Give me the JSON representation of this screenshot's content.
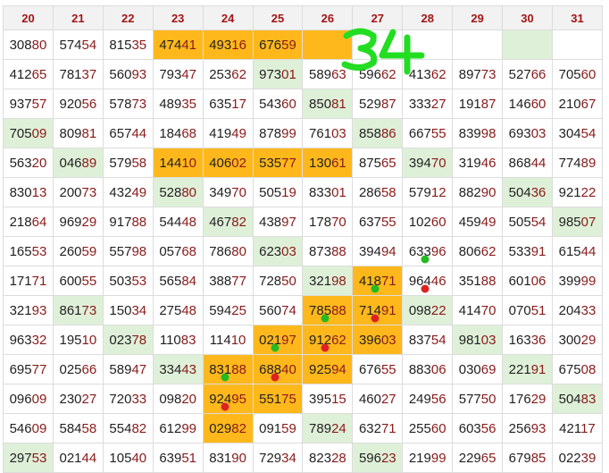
{
  "headers": [
    "20",
    "21",
    "22",
    "23",
    "24",
    "25",
    "26",
    "27",
    "28",
    "29",
    "30",
    "31"
  ],
  "rows": [
    [
      "30880",
      "57454",
      "81535",
      "47441",
      "49316",
      "67659",
      "",
      "",
      "",
      "",
      "",
      ""
    ],
    [
      "41265",
      "78137",
      "56093",
      "79347",
      "25362",
      "97301",
      "58963",
      "59662",
      "41362",
      "89773",
      "52766",
      "70560"
    ],
    [
      "93757",
      "92056",
      "57873",
      "48935",
      "63517",
      "54360",
      "85081",
      "52987",
      "33327",
      "19187",
      "14660",
      "21067"
    ],
    [
      "70509",
      "80981",
      "65744",
      "18468",
      "41949",
      "87899",
      "76103",
      "85886",
      "66755",
      "83998",
      "69303",
      "30454"
    ],
    [
      "56320",
      "04689",
      "57958",
      "14410",
      "40602",
      "53577",
      "13061",
      "87565",
      "39470",
      "31946",
      "86844",
      "77489"
    ],
    [
      "83013",
      "20073",
      "43249",
      "52880",
      "34970",
      "50519",
      "83301",
      "28658",
      "57912",
      "88290",
      "50436",
      "92122"
    ],
    [
      "21864",
      "96929",
      "91788",
      "54448",
      "46782",
      "43897",
      "17870",
      "63755",
      "10260",
      "45949",
      "50554",
      "98507"
    ],
    [
      "16553",
      "26059",
      "55798",
      "05768",
      "78680",
      "62303",
      "87388",
      "39494",
      "63396",
      "80662",
      "53391",
      "61544"
    ],
    [
      "17171",
      "60055",
      "50353",
      "56584",
      "38877",
      "72850",
      "32198",
      "41871",
      "96446",
      "35188",
      "60106",
      "39999"
    ],
    [
      "32193",
      "86173",
      "15034",
      "27548",
      "59425",
      "56074",
      "78588",
      "71491",
      "09822",
      "41470",
      "07051",
      "20433"
    ],
    [
      "96332",
      "19510",
      "02378",
      "11083",
      "11410",
      "02197",
      "91262",
      "39603",
      "83754",
      "98103",
      "16336",
      "30029"
    ],
    [
      "69577",
      "02566",
      "58947",
      "33443",
      "83188",
      "68840",
      "92594",
      "67655",
      "88306",
      "03069",
      "22191",
      "67508"
    ],
    [
      "09609",
      "23027",
      "72033",
      "09820",
      "92495",
      "55175",
      "39515",
      "46027",
      "24956",
      "57750",
      "17629",
      "50483"
    ],
    [
      "54609",
      "58458",
      "55482",
      "61299",
      "02982",
      "09159",
      "78924",
      "63271",
      "25560",
      "60356",
      "25693",
      "42117"
    ],
    [
      "29753",
      "02144",
      "10540",
      "63951",
      "83190",
      "72934",
      "82328",
      "59623",
      "21999",
      "22965",
      "67985",
      "02239"
    ]
  ],
  "highlight_colors": {
    "green": "#dff0d8",
    "orange": "#ffb81c",
    "header_text": "#a31515"
  },
  "handwritten_note": "34",
  "green_cells": [
    [
      0,
      10
    ],
    [
      1,
      5
    ],
    [
      2,
      6
    ],
    [
      3,
      0
    ],
    [
      3,
      7
    ],
    [
      4,
      1
    ],
    [
      4,
      8
    ],
    [
      5,
      3
    ],
    [
      5,
      10
    ],
    [
      6,
      4
    ],
    [
      6,
      11
    ],
    [
      7,
      5
    ],
    [
      8,
      6
    ],
    [
      9,
      1
    ],
    [
      9,
      8
    ],
    [
      10,
      2
    ],
    [
      10,
      9
    ],
    [
      11,
      3
    ],
    [
      11,
      10
    ],
    [
      12,
      11
    ],
    [
      13,
      6
    ],
    [
      14,
      0
    ],
    [
      14,
      7
    ]
  ],
  "orange_cells": [
    [
      0,
      3
    ],
    [
      0,
      4
    ],
    [
      0,
      5
    ],
    [
      0,
      6
    ],
    [
      4,
      3
    ],
    [
      4,
      4
    ],
    [
      4,
      5
    ],
    [
      4,
      6
    ],
    [
      8,
      7
    ],
    [
      9,
      6
    ],
    [
      9,
      7
    ],
    [
      10,
      5
    ],
    [
      10,
      6
    ],
    [
      10,
      7
    ],
    [
      11,
      4
    ],
    [
      11,
      5
    ],
    [
      11,
      6
    ],
    [
      12,
      4
    ],
    [
      12,
      5
    ],
    [
      13,
      4
    ]
  ],
  "dots": [
    {
      "row": 7,
      "col": 8,
      "color": "#22bb22"
    },
    {
      "row": 8,
      "col": 7,
      "color": "#22bb22"
    },
    {
      "row": 8,
      "col": 8,
      "color": "#dd2222"
    },
    {
      "row": 9,
      "col": 6,
      "color": "#22bb22"
    },
    {
      "row": 9,
      "col": 7,
      "color": "#dd2222"
    },
    {
      "row": 10,
      "col": 5,
      "color": "#22bb22"
    },
    {
      "row": 10,
      "col": 6,
      "color": "#dd2222"
    },
    {
      "row": 11,
      "col": 4,
      "color": "#22bb22"
    },
    {
      "row": 11,
      "col": 5,
      "color": "#dd2222"
    },
    {
      "row": 12,
      "col": 4,
      "color": "#dd2222"
    }
  ]
}
